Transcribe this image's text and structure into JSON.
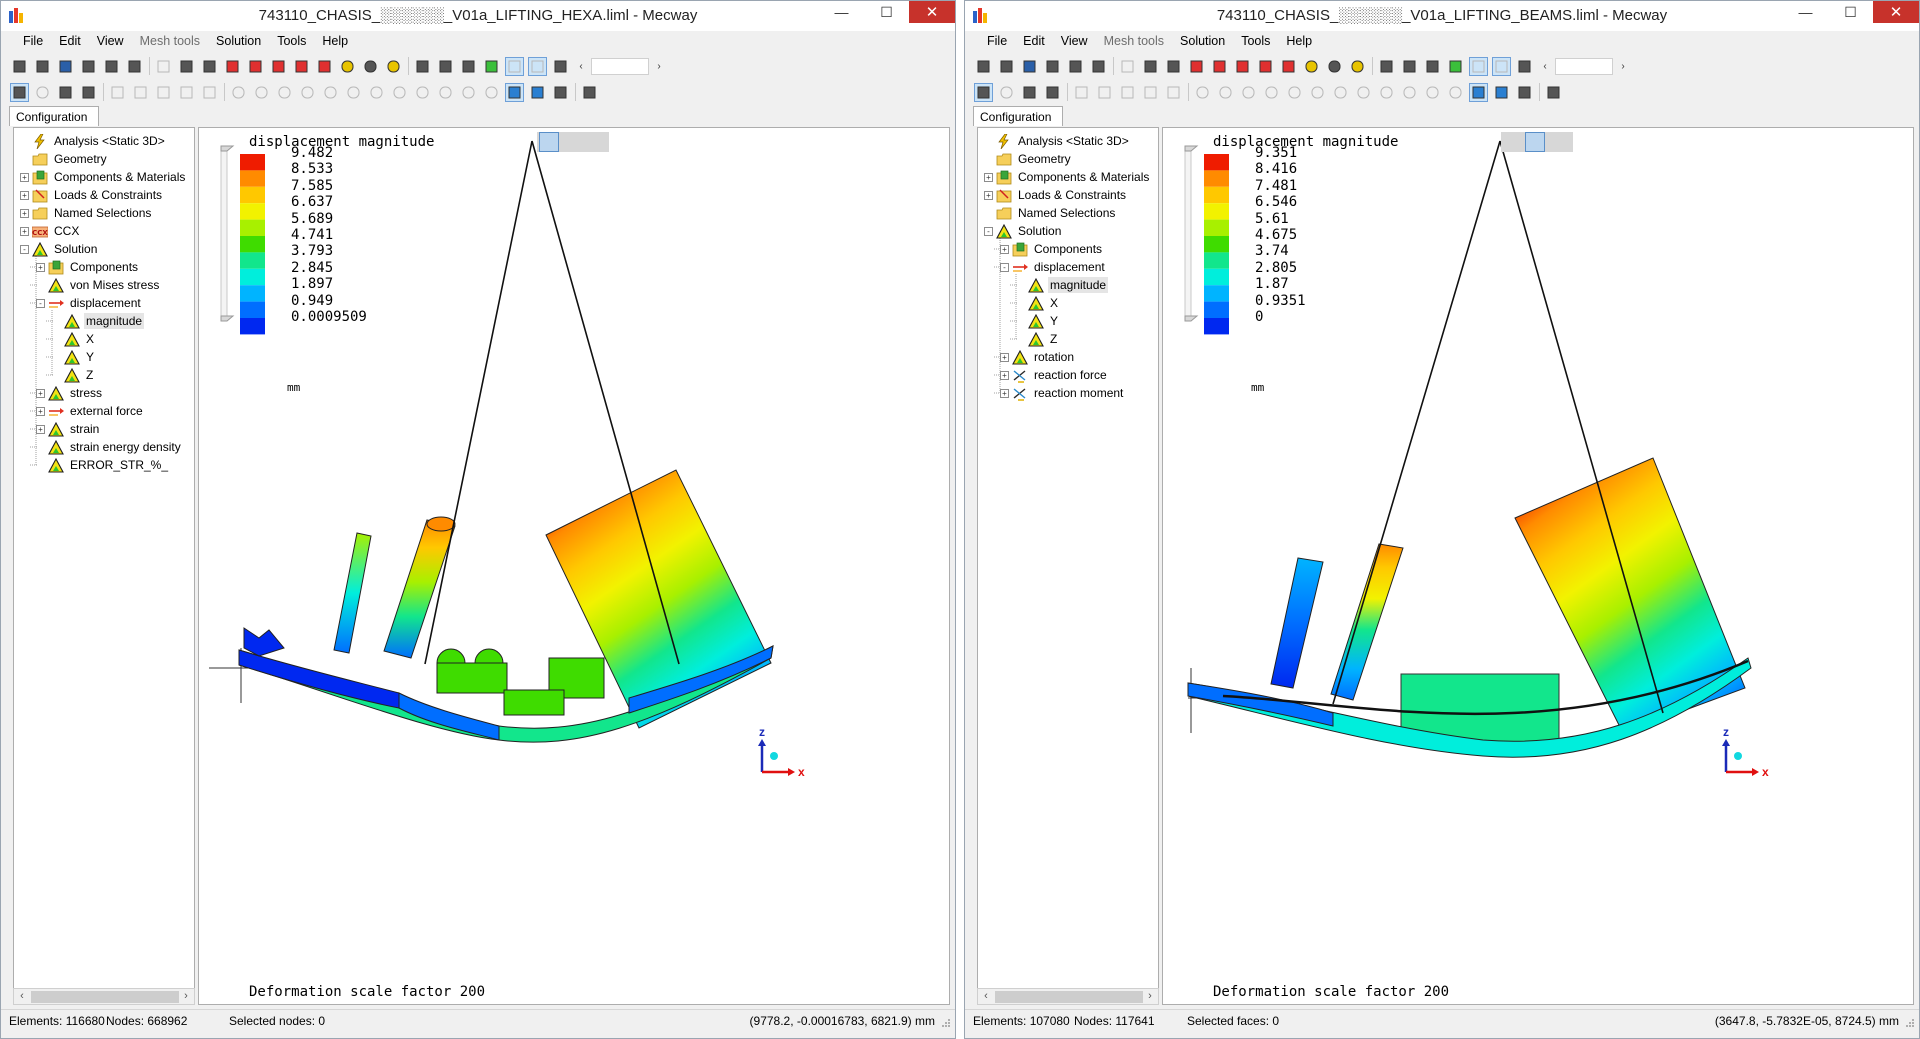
{
  "windows": [
    {
      "id": "A",
      "title": "743110_CHASIS_░░░░░░_V01a_LIFTING_HEXA.liml - Mecway",
      "menu": [
        "File",
        "Edit",
        "View",
        "Mesh tools",
        "Solution",
        "Tools",
        "Help"
      ],
      "config_tab": "Configuration",
      "tree": [
        {
          "label": "Analysis <Static 3D>",
          "icon": "lightning-icon",
          "level": 0,
          "exp": ""
        },
        {
          "label": "Geometry",
          "icon": "folder-icon",
          "level": 0,
          "exp": ""
        },
        {
          "label": "Components & Materials",
          "icon": "components-icon",
          "level": 0,
          "exp": "+"
        },
        {
          "label": "Loads & Constraints",
          "icon": "loads-icon",
          "level": 0,
          "exp": "+"
        },
        {
          "label": "Named Selections",
          "icon": "folder-icon",
          "level": 0,
          "exp": "+"
        },
        {
          "label": "CCX",
          "icon": "ccx-icon",
          "level": 0,
          "exp": "+"
        },
        {
          "label": "Solution",
          "icon": "warning-triangle-icon",
          "level": 0,
          "exp": "-"
        },
        {
          "label": "Components",
          "icon": "components-icon",
          "level": 1,
          "exp": "+"
        },
        {
          "label": "von Mises stress",
          "icon": "warning-triangle-icon",
          "level": 1,
          "exp": ""
        },
        {
          "label": "displacement",
          "icon": "arrow-icon",
          "level": 1,
          "exp": "-"
        },
        {
          "label": "magnitude",
          "icon": "warning-triangle-icon",
          "level": 2,
          "exp": "",
          "selected": true
        },
        {
          "label": "X",
          "icon": "warning-triangle-icon",
          "level": 2,
          "exp": ""
        },
        {
          "label": "Y",
          "icon": "warning-triangle-icon",
          "level": 2,
          "exp": ""
        },
        {
          "label": "Z",
          "icon": "warning-triangle-icon",
          "level": 2,
          "exp": ""
        },
        {
          "label": "stress",
          "icon": "warning-triangle-icon",
          "level": 1,
          "exp": "+"
        },
        {
          "label": "external force",
          "icon": "arrow-icon",
          "level": 1,
          "exp": "+"
        },
        {
          "label": "strain",
          "icon": "warning-triangle-icon",
          "level": 1,
          "exp": "+"
        },
        {
          "label": "strain energy density",
          "icon": "warning-triangle-icon",
          "level": 1,
          "exp": ""
        },
        {
          "label": "ERROR_STR_%_",
          "icon": "warning-triangle-icon",
          "level": 1,
          "exp": ""
        }
      ],
      "legend": {
        "title": "displacement magnitude",
        "values": [
          "9.482",
          "8.533",
          "7.585",
          "6.637",
          "5.689",
          "4.741",
          "3.793",
          "2.845",
          "1.897",
          "0.949",
          "0.0009509"
        ],
        "unit": "mm"
      },
      "deformation_text": "Deformation scale factor 200",
      "axis_labels": {
        "z": "z",
        "x": "x"
      },
      "status": {
        "elements": "Elements: 116680",
        "nodes": "Nodes: 668962",
        "selected": "Selected nodes: 0",
        "coords": "(9778.2, -0.00016783, 6821.9) mm"
      }
    },
    {
      "id": "B",
      "title": "743110_CHASIS_░░░░░░_V01a_LIFTING_BEAMS.liml - Mecway",
      "menu": [
        "File",
        "Edit",
        "View",
        "Mesh tools",
        "Solution",
        "Tools",
        "Help"
      ],
      "config_tab": "Configuration",
      "tree": [
        {
          "label": "Analysis <Static 3D>",
          "icon": "lightning-icon",
          "level": 0,
          "exp": ""
        },
        {
          "label": "Geometry",
          "icon": "folder-icon",
          "level": 0,
          "exp": ""
        },
        {
          "label": "Components & Materials",
          "icon": "components-icon",
          "level": 0,
          "exp": "+"
        },
        {
          "label": "Loads & Constraints",
          "icon": "loads-icon",
          "level": 0,
          "exp": "+"
        },
        {
          "label": "Named Selections",
          "icon": "folder-icon",
          "level": 0,
          "exp": ""
        },
        {
          "label": "Solution",
          "icon": "warning-triangle-icon",
          "level": 0,
          "exp": "-"
        },
        {
          "label": "Components",
          "icon": "components-icon",
          "level": 1,
          "exp": "+"
        },
        {
          "label": "displacement",
          "icon": "arrow-icon",
          "level": 1,
          "exp": "-"
        },
        {
          "label": "magnitude",
          "icon": "warning-triangle-icon",
          "level": 2,
          "exp": "",
          "selected": true
        },
        {
          "label": "X",
          "icon": "warning-triangle-icon",
          "level": 2,
          "exp": ""
        },
        {
          "label": "Y",
          "icon": "warning-triangle-icon",
          "level": 2,
          "exp": ""
        },
        {
          "label": "Z",
          "icon": "warning-triangle-icon",
          "level": 2,
          "exp": ""
        },
        {
          "label": "rotation",
          "icon": "warning-triangle-icon",
          "level": 1,
          "exp": "+"
        },
        {
          "label": "reaction force",
          "icon": "reaction-icon",
          "level": 1,
          "exp": "+"
        },
        {
          "label": "reaction moment",
          "icon": "reaction-icon",
          "level": 1,
          "exp": "+"
        }
      ],
      "legend": {
        "title": "displacement magnitude",
        "values": [
          "9.351",
          "8.416",
          "7.481",
          "6.546",
          "5.61",
          "4.675",
          "3.74",
          "2.805",
          "1.87",
          "0.9351",
          "0"
        ],
        "unit": "mm"
      },
      "deformation_text": "Deformation scale factor 200",
      "axis_labels": {
        "z": "z",
        "x": "x"
      },
      "status": {
        "elements": "Elements: 107080",
        "nodes": "Nodes: 117641",
        "selected": "Selected faces: 0",
        "coords": "(3647.8, -5.7832E-05, 8724.5) mm"
      }
    }
  ],
  "legend_colors": [
    "#ef1c00",
    "#ff8b00",
    "#ffc800",
    "#f2f200",
    "#a8f000",
    "#3fdc00",
    "#12e68c",
    "#00eedc",
    "#00b4ff",
    "#006eff",
    "#0028f0"
  ],
  "caption_buttons": {
    "minimize": "—",
    "maximize": "☐",
    "close": "✕"
  },
  "scroll_arrows": {
    "left": "‹",
    "right": "›"
  }
}
